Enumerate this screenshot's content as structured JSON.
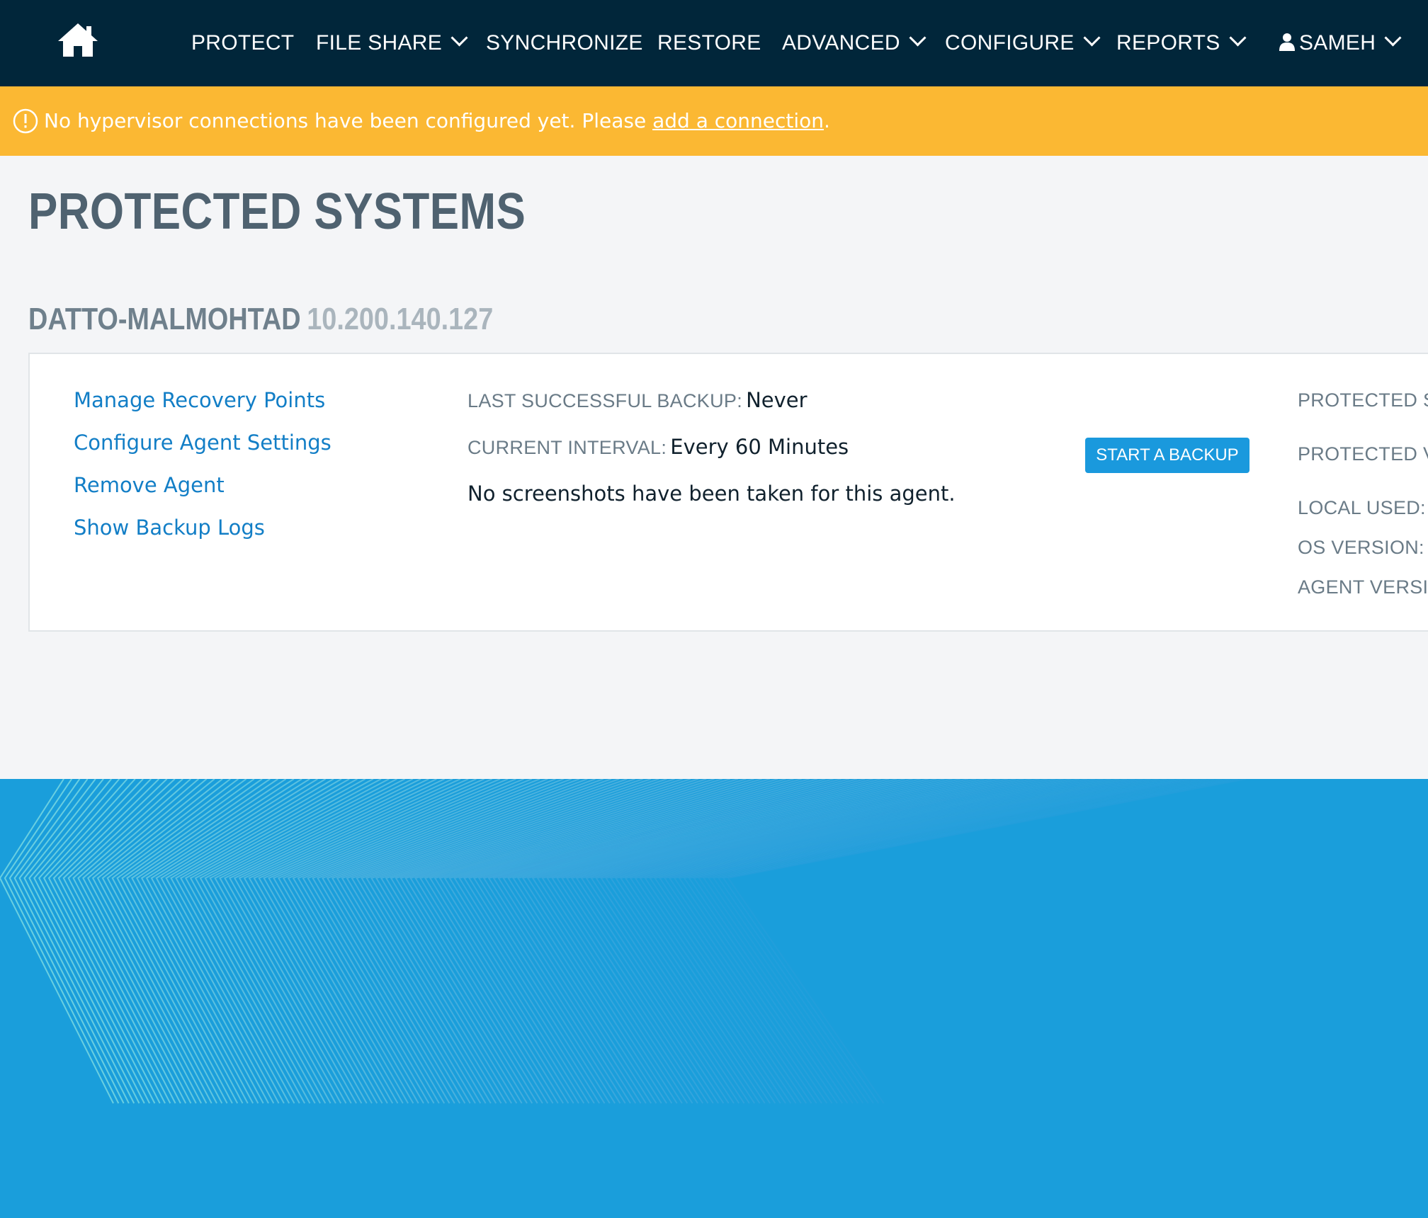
{
  "nav": {
    "home_icon": "home-icon",
    "items": [
      {
        "label": "PROTECT",
        "has_dropdown": false
      },
      {
        "label": "FILE SHARE",
        "has_dropdown": true
      },
      {
        "label": "SYNCHRONIZE",
        "has_dropdown": false
      },
      {
        "label": "RESTORE",
        "has_dropdown": false
      },
      {
        "label": "ADVANCED",
        "has_dropdown": true
      },
      {
        "label": "CONFIGURE",
        "has_dropdown": true
      },
      {
        "label": "REPORTS",
        "has_dropdown": true
      }
    ],
    "user": {
      "label": "SAMEH",
      "icon": "user-icon",
      "has_dropdown": true
    }
  },
  "banner": {
    "icon": "alert-circle-icon",
    "message": "No hypervisor connections have been configured yet. Please ",
    "link_text": "add a connection",
    "suffix": "."
  },
  "page": {
    "title": "PROTECTED SYSTEMS"
  },
  "agent": {
    "name": "DATTO-MALMOHTAD",
    "ip": "10.200.140.127",
    "links": [
      "Manage Recovery Points",
      "Configure Agent Settings",
      "Remove Agent",
      "Show Backup Logs"
    ],
    "last_backup_label": "LAST SUCCESSFUL BACKUP:",
    "last_backup_value": "Never",
    "interval_label": "CURRENT INTERVAL:",
    "interval_value": "Every 60 Minutes",
    "screenshot_note": "No screenshots have been taken for this agent.",
    "start_backup_label": "START A BACKUP",
    "right_labels": [
      "PROTECTED ST",
      "PROTECTED VO",
      "LOCAL USED:",
      "OS VERSION:",
      "AGENT VERSIO"
    ]
  },
  "colors": {
    "nav_bg": "#01263a",
    "banner_bg": "#fbb833",
    "link": "#127ec6",
    "button": "#1a99dd",
    "footer": "#1a9edb",
    "page_bg": "#f4f5f7"
  }
}
